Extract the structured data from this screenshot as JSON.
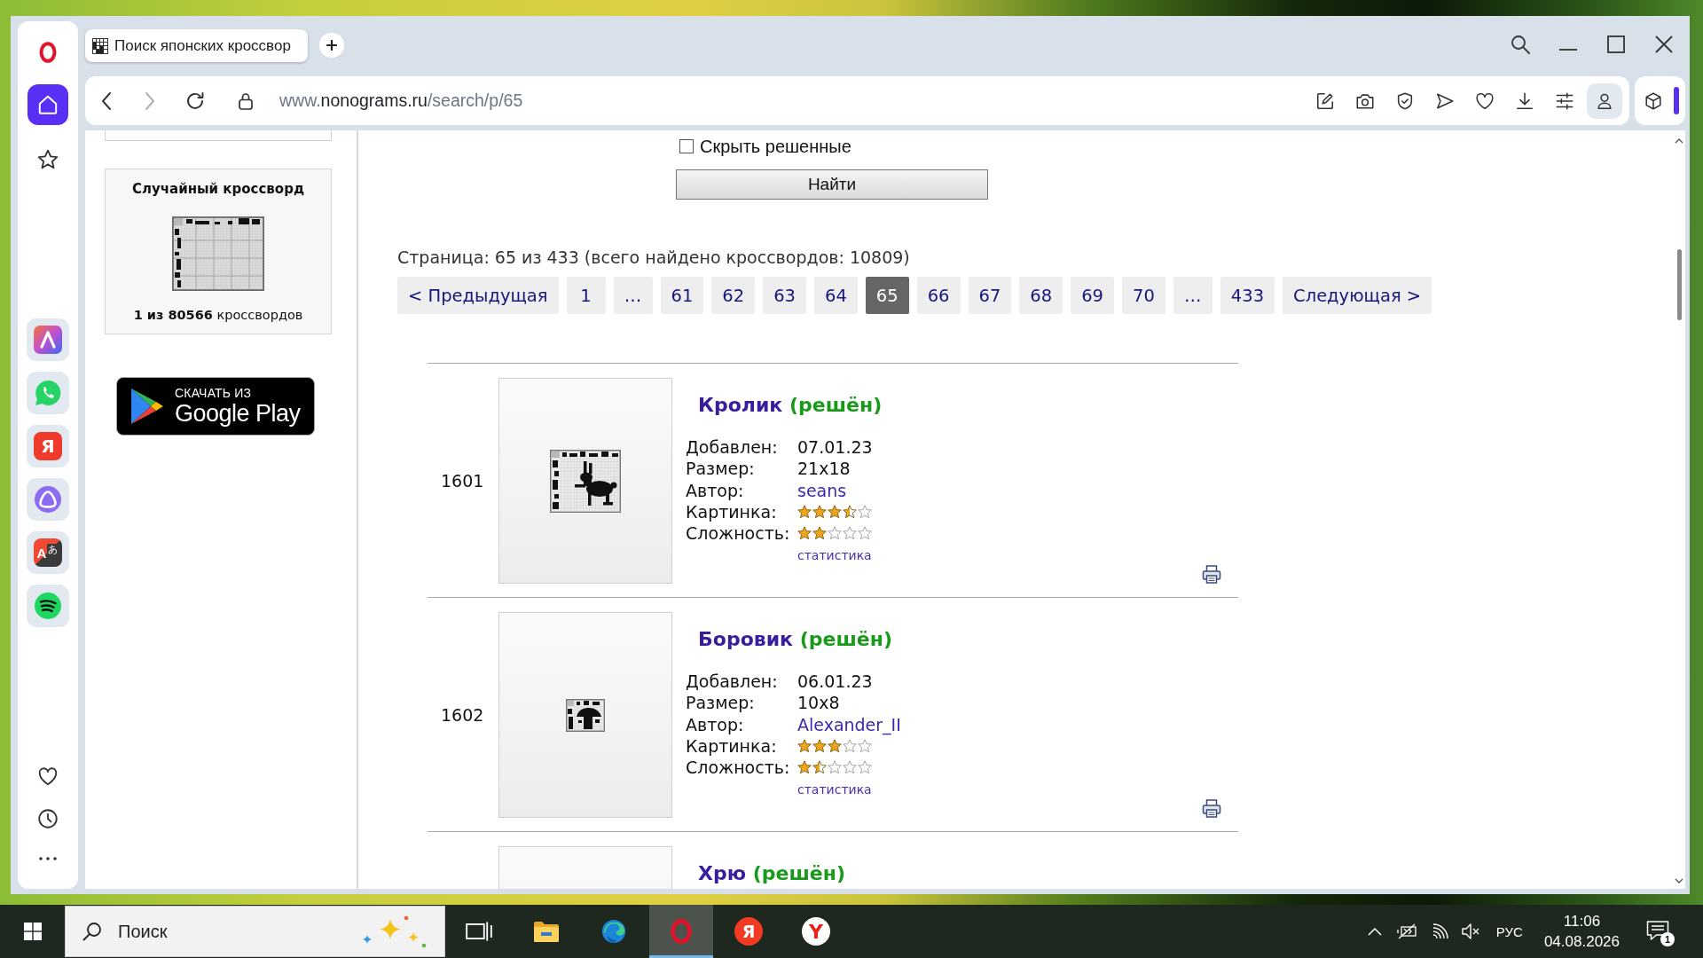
{
  "browser": {
    "tabs": [
      {
        "title": "Поиск японских кроссвор",
        "selected": true
      }
    ],
    "nav_buttons": [
      {
        "kind": "back",
        "disabled": false
      },
      {
        "kind": "forward",
        "disabled": true
      },
      {
        "kind": "reload",
        "disabled": false
      }
    ],
    "address": {
      "prefix": "www.",
      "host": "nonograms.ru",
      "path": "/search/p/65"
    },
    "toolbar": [
      {
        "kind": "edit"
      },
      {
        "kind": "camera"
      },
      {
        "kind": "shield"
      },
      {
        "kind": "send"
      },
      {
        "kind": "heart"
      },
      {
        "kind": "download"
      },
      {
        "kind": "sliders"
      },
      {
        "kind": "profile"
      }
    ]
  },
  "sidebar": {
    "nav": [
      {
        "kind": "home",
        "selected": true
      },
      {
        "kind": "star",
        "selected": false
      }
    ],
    "apps": [
      {
        "kind": "assistant"
      },
      {
        "kind": "chat"
      },
      {
        "kind": "letter",
        "glyph": "Я"
      },
      {
        "kind": "ring"
      },
      {
        "kind": "translate",
        "glyphs": [
          "A",
          "あ"
        ]
      },
      {
        "kind": "music"
      }
    ],
    "bottom": [
      {
        "kind": "heart"
      },
      {
        "kind": "clock"
      },
      {
        "kind": "more"
      }
    ]
  },
  "page": {
    "random_crossword": {
      "title": "Случайный кроссворд",
      "caption": "**1 из 80566** кроссвордов"
    },
    "store_badge": {
      "caption": "СКАЧАТЬ ИЗ",
      "name": "Google Play"
    },
    "filter": {
      "hide_solved": {
        "label": "Скрыть решенные",
        "checked": false
      },
      "submit": "Найти"
    },
    "pagination": {
      "summary": "Страница: 65 из 433 (всего найдено кроссвордов: 10809)",
      "pages": [
        {
          "label": "< Предыдущая",
          "selected": false
        },
        {
          "label": "1",
          "selected": false
        },
        {
          "label": "…",
          "selected": false
        },
        {
          "label": "61",
          "selected": false
        },
        {
          "label": "62",
          "selected": false
        },
        {
          "label": "63",
          "selected": false
        },
        {
          "label": "64",
          "selected": false
        },
        {
          "label": "65",
          "selected": true
        },
        {
          "label": "66",
          "selected": false
        },
        {
          "label": "67",
          "selected": false
        },
        {
          "label": "68",
          "selected": false
        },
        {
          "label": "69",
          "selected": false
        },
        {
          "label": "70",
          "selected": false
        },
        {
          "label": "…",
          "selected": false
        },
        {
          "label": "433",
          "selected": false
        },
        {
          "label": "Следующая >",
          "selected": false
        }
      ]
    },
    "results": [
      {
        "number": "1601",
        "title": "Кролик",
        "status": "(решён)",
        "fields": [
          {
            "kind": "text",
            "label": "Добавлен:",
            "value": "07.01.23"
          },
          {
            "kind": "text",
            "label": "Размер:",
            "value": "21x18"
          },
          {
            "kind": "link",
            "label": "Автор:",
            "value": "seans"
          },
          {
            "kind": "stars",
            "label": "Картинка:",
            "stars": 3.5
          },
          {
            "kind": "stars",
            "label": "Сложность:",
            "stars": 2
          }
        ],
        "stats_link": "статистика",
        "printable": true
      },
      {
        "number": "1602",
        "title": "Боровик",
        "status": "(решён)",
        "fields": [
          {
            "kind": "text",
            "label": "Добавлен:",
            "value": "06.01.23"
          },
          {
            "kind": "text",
            "label": "Размер:",
            "value": "10x8"
          },
          {
            "kind": "link",
            "label": "Автор:",
            "value": "Alexander_II"
          },
          {
            "kind": "stars",
            "label": "Картинка:",
            "stars": 3
          },
          {
            "kind": "stars",
            "label": "Сложность:",
            "stars": 1.5
          }
        ],
        "stats_link": "статистика",
        "printable": true
      },
      {
        "title": "Хрю",
        "status": "(решён)"
      }
    ]
  },
  "taskbar": {
    "search": {
      "placeholder": "Поиск"
    },
    "apps": [
      {
        "kind": "task-view",
        "selected": false
      },
      {
        "kind": "folder",
        "selected": false
      },
      {
        "kind": "swirl",
        "selected": false
      },
      {
        "kind": "ring",
        "selected": true
      },
      {
        "kind": "letter",
        "glyph": "Я",
        "selected": false
      },
      {
        "kind": "letter-circle",
        "glyph": "Y",
        "selected": false
      }
    ],
    "tray": {
      "language": "РУС",
      "time": "11:06",
      "date": "04.08.2026",
      "notifications": "1"
    }
  }
}
